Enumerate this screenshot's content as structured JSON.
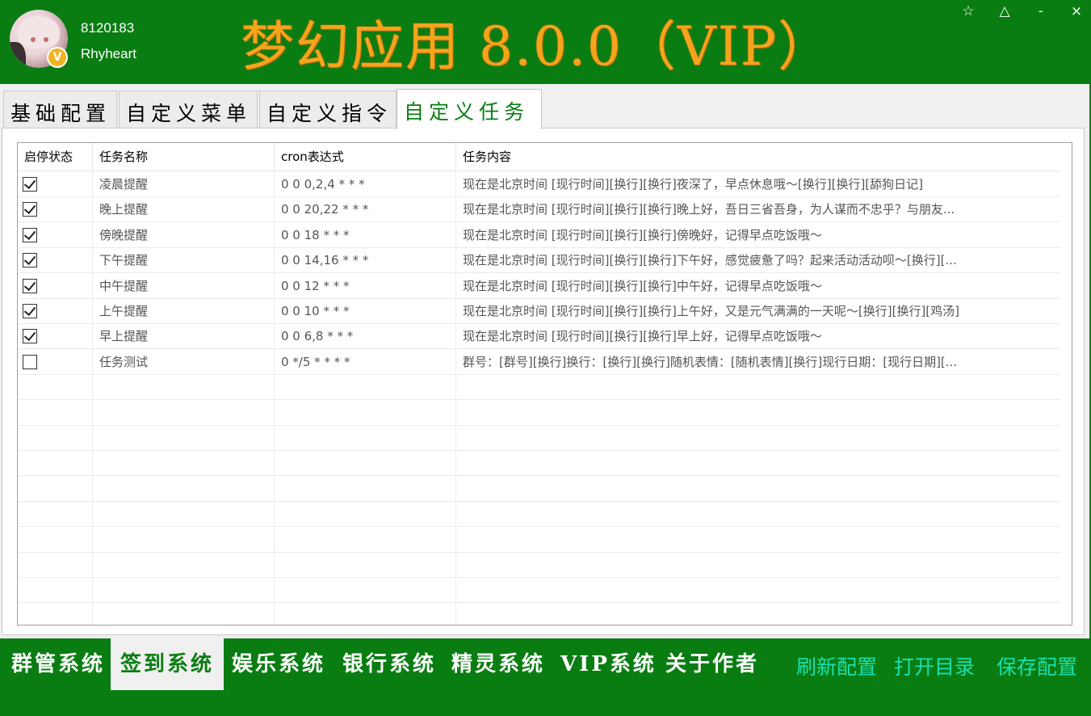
{
  "header": {
    "user_id": "8120183",
    "user_name": "Rhyheart",
    "vip_badge": "V",
    "app_title": "梦幻应用 8.0.0（VIP）",
    "title_color": "#f5a51c",
    "window_buttons": {
      "pin": "☆",
      "skin": "△",
      "minimize": "-",
      "close": "×"
    }
  },
  "tabs": [
    {
      "label": "基础配置",
      "active": false
    },
    {
      "label": "自定义菜单",
      "active": false
    },
    {
      "label": "自定义指令",
      "active": false
    },
    {
      "label": "自定义任务",
      "active": true
    }
  ],
  "table": {
    "columns": [
      "启停状态",
      "任务名称",
      "cron表达式",
      "任务内容"
    ],
    "rows": [
      {
        "enabled": true,
        "name": "凌晨提醒",
        "cron": "0 0 0,2,4 * * *",
        "content": "现在是北京时间 [现行时间][换行][换行]夜深了，早点休息哦～[换行][换行][舔狗日记]"
      },
      {
        "enabled": true,
        "name": "晚上提醒",
        "cron": "0 0 20,22 * * *",
        "content": "现在是北京时间 [现行时间][换行][换行]晚上好，吾日三省吾身，为人谋而不忠乎？与朋友..."
      },
      {
        "enabled": true,
        "name": "傍晚提醒",
        "cron": "0 0 18 * * *",
        "content": "现在是北京时间 [现行时间][换行][换行]傍晚好，记得早点吃饭哦～"
      },
      {
        "enabled": true,
        "name": "下午提醒",
        "cron": "0 0 14,16 * * *",
        "content": "现在是北京时间 [现行时间][换行][换行]下午好，感觉疲惫了吗？起来活动活动呗～[换行][..."
      },
      {
        "enabled": true,
        "name": "中午提醒",
        "cron": "0 0 12 * * *",
        "content": "现在是北京时间 [现行时间][换行][换行]中午好，记得早点吃饭哦～"
      },
      {
        "enabled": true,
        "name": "上午提醒",
        "cron": "0 0 10 * * *",
        "content": "现在是北京时间 [现行时间][换行][换行]上午好，又是元气满满的一天呢～[换行][换行][鸡汤]"
      },
      {
        "enabled": true,
        "name": "早上提醒",
        "cron": "0 0 6,8 * * *",
        "content": "现在是北京时间 [现行时间][换行][换行]早上好，记得早点吃饭哦～"
      },
      {
        "enabled": false,
        "name": "任务测试",
        "cron": "0 */5 * * * *",
        "content": "群号：[群号][换行]换行：[换行][换行]随机表情：[随机表情][换行]现行日期：[现行日期][..."
      }
    ]
  },
  "bottom_nav": [
    {
      "label": "群管系统",
      "active": false
    },
    {
      "label": "签到系统",
      "active": true
    },
    {
      "label": "娱乐系统",
      "active": false
    },
    {
      "label": "银行系统",
      "active": false
    },
    {
      "label": "精灵系统",
      "active": false
    },
    {
      "label": "VIP系统",
      "active": false
    },
    {
      "label": "关于作者",
      "active": false
    }
  ],
  "bottom_actions": {
    "refresh": "刷新配置",
    "open_dir": "打开目录",
    "save": "保存配置",
    "color": "#19e0b0"
  },
  "colors": {
    "theme_green": "#0a7d12",
    "panel_bg": "#f0f0f0"
  }
}
